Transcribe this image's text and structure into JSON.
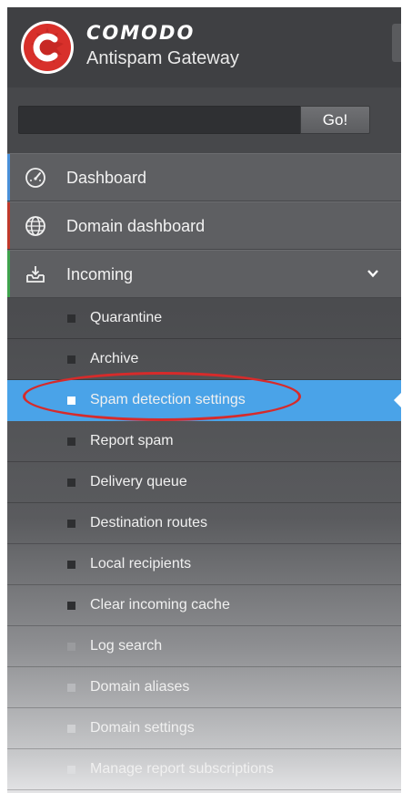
{
  "brand": {
    "name": "COMODO",
    "product": "Antispam Gateway",
    "logo_letter": "C",
    "colors": {
      "logo_red": "#d8302b",
      "logo_white": "#ffffff"
    }
  },
  "search": {
    "value": "",
    "placeholder": "",
    "button_label": "Go!"
  },
  "nav": {
    "main_items": [
      {
        "label": "Dashboard",
        "icon": "speedometer-icon",
        "accent": "#4a90d9"
      },
      {
        "label": "Domain dashboard",
        "icon": "globe-icon",
        "accent": "#c0392b"
      },
      {
        "label": "Incoming",
        "icon": "inbox-download-icon",
        "accent": "#3fa34d",
        "expanded": true
      }
    ],
    "incoming_items": [
      {
        "label": "Quarantine"
      },
      {
        "label": "Archive"
      },
      {
        "label": "Spam detection settings",
        "active": true
      },
      {
        "label": "Report spam"
      },
      {
        "label": "Delivery queue"
      },
      {
        "label": "Destination routes"
      },
      {
        "label": "Local recipients"
      },
      {
        "label": "Clear incoming cache"
      },
      {
        "label": "Log search"
      },
      {
        "label": "Domain aliases"
      },
      {
        "label": "Domain settings"
      },
      {
        "label": "Manage report subscriptions"
      }
    ]
  },
  "colors": {
    "sidebar_bg": "#4b4c4f",
    "nav_main_bg": "#5e5f62",
    "active_bg": "#4aa3e8",
    "highlight_oval": "#d62b2b"
  }
}
